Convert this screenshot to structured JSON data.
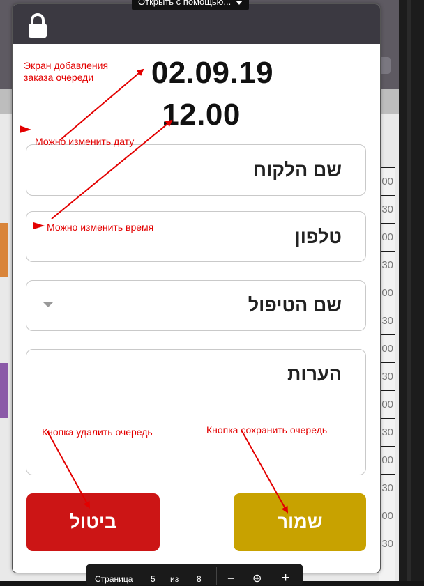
{
  "top_overlay": {
    "open_with_label": "Открыть с помощью..."
  },
  "dialog": {
    "date": "02.09.19",
    "time": "12.00",
    "fields": {
      "customer_name_placeholder": "שם הלקוח",
      "phone_placeholder": "טלפון",
      "treatment_name_placeholder": "שם הטיפול",
      "notes_placeholder": "הערות"
    },
    "buttons": {
      "cancel_label": "ביטול",
      "save_label": "שמור"
    }
  },
  "annotations": {
    "screen_title": "Экран добавления заказа  очереди",
    "change_date": "Можно изменить дату",
    "change_time": "Можно изменить время",
    "delete_button": "Кнопка удалить очередь",
    "save_button": "Кнопка сохранить очередь"
  },
  "background_times": [
    "00",
    "30",
    "00",
    "30",
    "00",
    "30",
    "00",
    "30",
    "00",
    "30",
    "00",
    "30",
    "00",
    "30"
  ],
  "page_bar": {
    "page_label": "Страница",
    "page_num": "5",
    "of_label": "из",
    "total": "8",
    "minus": "−",
    "zoom_icon": "⊕",
    "plus": "+"
  },
  "colors": {
    "dialog_header": "#3b3941",
    "cancel": "#cc1515",
    "save": "#c8a200",
    "annotation": "#e30000"
  },
  "icons": [
    "lock-icon",
    "dropdown-caret-icon",
    "chevron-down-icon",
    "zoom-icon"
  ]
}
